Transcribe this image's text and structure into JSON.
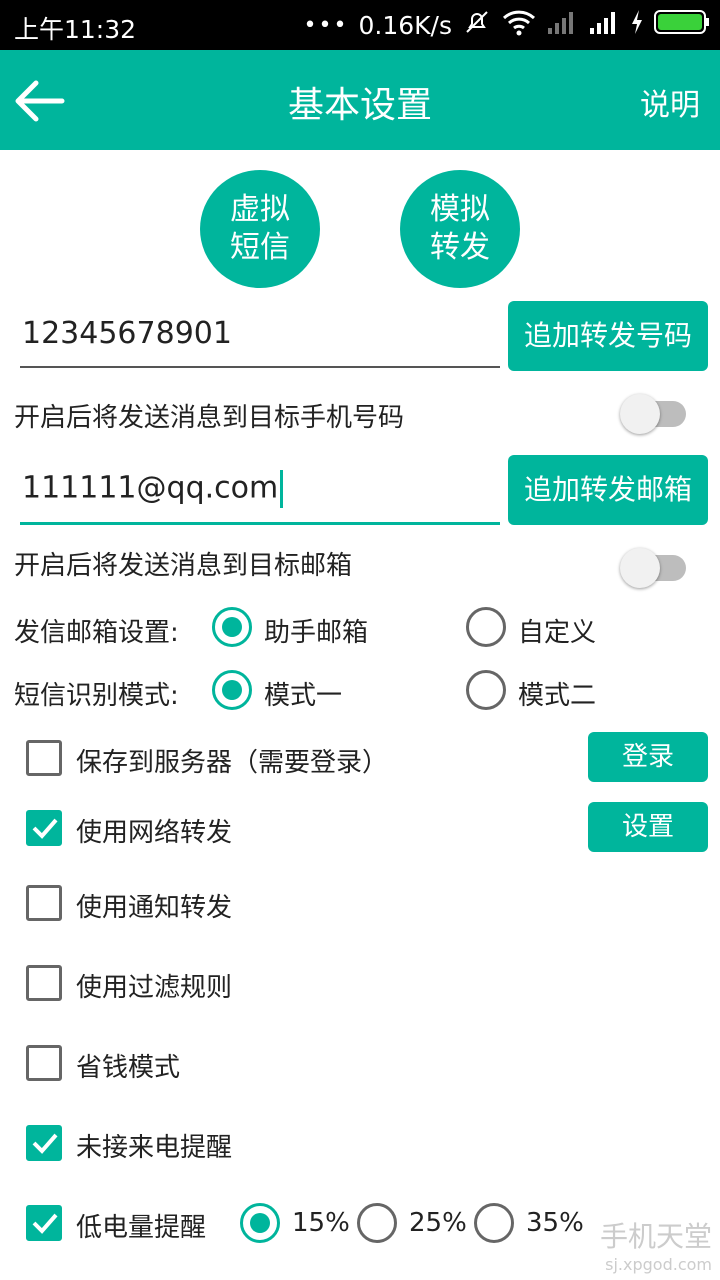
{
  "status_bar": {
    "time": "上午11:32",
    "speed": "0.16K/s"
  },
  "app_bar": {
    "title": "基本设置",
    "help_label": "说明"
  },
  "top_buttons": [
    {
      "line1": "虚拟",
      "line2": "短信"
    },
    {
      "line1": "模拟",
      "line2": "转发"
    }
  ],
  "phone": {
    "value": "12345678901",
    "add_label": "追加转发号码",
    "toggle_label": "开启后将发送消息到目标手机号码",
    "enabled": false
  },
  "email": {
    "value": "111111@qq.com",
    "add_label": "追加转发邮箱",
    "toggle_label": "开启后将发送消息到目标邮箱",
    "enabled": false
  },
  "sender_mailbox": {
    "label": "发信邮箱设置:",
    "options": [
      "助手邮箱",
      "自定义"
    ],
    "selected": "助手邮箱"
  },
  "sms_mode": {
    "label": "短信识别模式:",
    "options": [
      "模式一",
      "模式二"
    ],
    "selected": "模式一"
  },
  "checkboxes": {
    "save_server": {
      "label": "保存到服务器（需要登录）",
      "checked": false,
      "button": "登录"
    },
    "network_forward": {
      "label": "使用网络转发",
      "checked": true,
      "button": "设置"
    },
    "notify_forward": {
      "label": "使用通知转发",
      "checked": false
    },
    "filter_rules": {
      "label": "使用过滤规则",
      "checked": false
    },
    "save_money": {
      "label": "省钱模式",
      "checked": false
    },
    "missed_call": {
      "label": "未接来电提醒",
      "checked": true
    },
    "low_battery": {
      "label": "低电量提醒",
      "checked": true
    }
  },
  "battery_levels": {
    "options": [
      "15%",
      "25%",
      "35%"
    ],
    "selected": "15%"
  },
  "watermark": {
    "brand": "手机天堂",
    "url": "sj.xpgod.com"
  },
  "colors": {
    "accent": "#00b59c",
    "status_bar": "#000000"
  }
}
